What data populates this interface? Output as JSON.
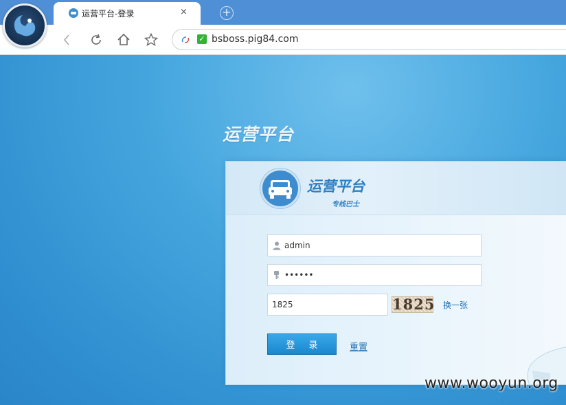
{
  "browser": {
    "tab_title": "运营平台-登录",
    "close_glyph": "×",
    "new_tab_glyph": "+",
    "url": "bsboss.pig84.com"
  },
  "page": {
    "title": "运营平台",
    "brand_title": "运营平台",
    "brand_subtitle": "专线巴士"
  },
  "form": {
    "username": "admin",
    "password": "••••••",
    "captcha_input": "1825",
    "captcha_image_text": "1825",
    "captcha_refresh": "换一张",
    "login_label": "登 录",
    "reset_label": "重置"
  },
  "watermark": "www.wooyun.org",
  "colors": {
    "tabbar": "#4f8fd6",
    "page_bg": "#3a9ad8",
    "button": "#1a87cf",
    "link": "#1f6fb5"
  }
}
